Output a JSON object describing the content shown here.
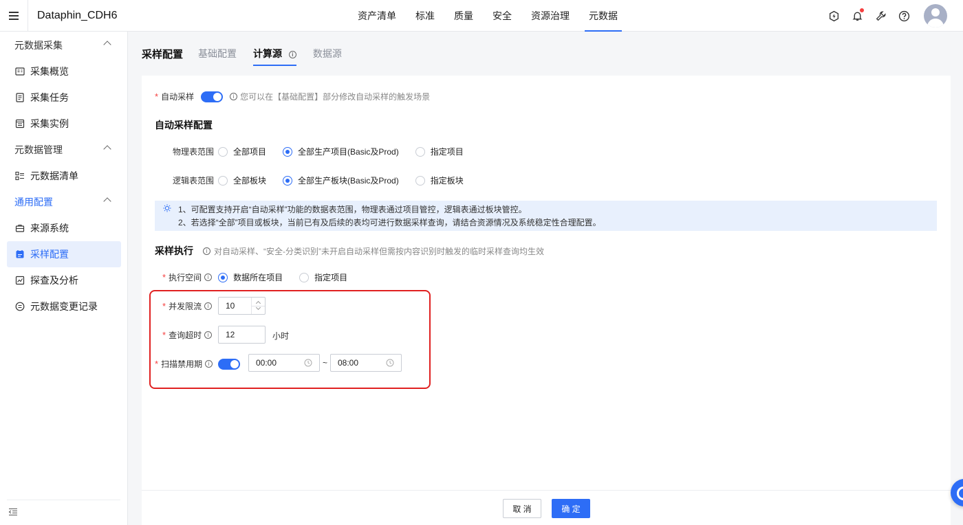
{
  "header": {
    "app_title": "Dataphin_CDH6",
    "nav": [
      "资产清单",
      "标准",
      "质量",
      "安全",
      "资源治理",
      "元数据"
    ],
    "active_nav": "元数据",
    "icons": [
      "flash-icon",
      "bell-icon",
      "wrench-icon",
      "help-icon"
    ]
  },
  "sidebar": {
    "groups": [
      {
        "label": "元数据采集",
        "items": [
          "采集概览",
          "采集任务",
          "采集实例"
        ]
      },
      {
        "label": "元数据管理",
        "items": [
          "元数据清单"
        ]
      },
      {
        "label": "通用配置",
        "items": [
          "来源系统",
          "采样配置",
          "探查及分析",
          "元数据变更记录"
        ]
      }
    ],
    "active_item": "采样配置"
  },
  "tabs": {
    "title": "采样配置",
    "items": [
      "基础配置",
      "计算源",
      "数据源"
    ],
    "active": "计算源",
    "info_mark": "ⓘ"
  },
  "form": {
    "auto_sample": {
      "required": "*",
      "label": "自动采样",
      "enabled": true,
      "hint": "您可以在【基础配置】部分修改自动采样的触发场景"
    },
    "auto_sample_config_title": "自动采样配置",
    "physical_scope": {
      "label": "物理表范围",
      "options": [
        "全部项目",
        "全部生产项目(Basic及Prod)",
        "指定项目"
      ],
      "selected": "全部生产项目(Basic及Prod)"
    },
    "logical_scope": {
      "label": "逻辑表范围",
      "options": [
        "全部板块",
        "全部生产板块(Basic及Prod)",
        "指定板块"
      ],
      "selected": "全部生产板块(Basic及Prod)"
    },
    "tip": {
      "line1": "1、可配置支持开启“自动采样”功能的数据表范围，物理表通过项目管控，逻辑表通过板块管控。",
      "line2": "2、若选择“全部”项目或板块，当前已有及后续的表均可进行数据采样查询，请结合资源情况及系统稳定性合理配置。"
    },
    "execution": {
      "title": "采样执行",
      "hint": "对自动采样、“安全-分类识别”未开启自动采样但需按内容识别时触发的临时采样查询均生效"
    },
    "exec_space": {
      "required": "*",
      "label": "执行空间",
      "options": [
        "数据所在项目",
        "指定项目"
      ],
      "selected": "数据所在项目"
    },
    "concurrency": {
      "required": "*",
      "label": "并发限流",
      "value": "10"
    },
    "query_timeout": {
      "required": "*",
      "label": "查询超时",
      "value": "12",
      "unit": "小时"
    },
    "scan_blackout": {
      "required": "*",
      "label": "扫描禁用期",
      "enabled": true,
      "start": "00:00",
      "separator": "~",
      "end": "08:00"
    }
  },
  "footer": {
    "cancel": "取 消",
    "ok": "确 定"
  },
  "colors": {
    "accent": "#2d6df6",
    "highlight_box": "#e02020",
    "tip_bg": "#e8f0fd"
  }
}
